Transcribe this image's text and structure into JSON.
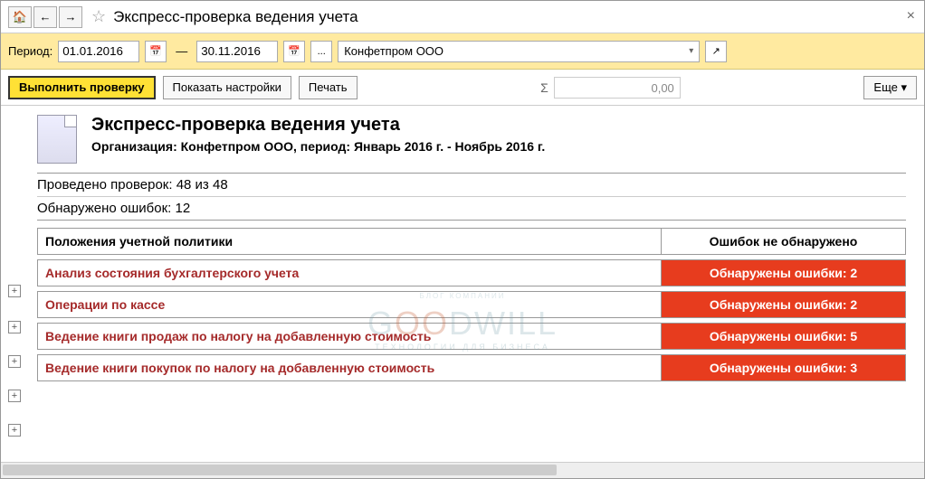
{
  "window": {
    "title": "Экспресс-проверка ведения учета"
  },
  "period": {
    "label": "Период:",
    "from": "01.01.2016",
    "to": "30.11.2016",
    "dash": "—",
    "ellipsis": "...",
    "org": "Конфетпром ООО"
  },
  "toolbar": {
    "run": "Выполнить проверку",
    "settings": "Показать настройки",
    "print": "Печать",
    "sigma": "Σ",
    "sum": "0,00",
    "more": "Еще"
  },
  "report": {
    "title": "Экспресс-проверка ведения учета",
    "subtitle": "Организация: Конфетпром ООО, период: Январь 2016 г. - Ноябрь 2016 г.",
    "checks_done": "Проведено проверок: 48 из 48",
    "errors_found": "Обнаружено ошибок: 12",
    "col_section": "Положения учетной политики",
    "col_status_ok": "Ошибок не обнаружено",
    "rows": [
      {
        "label": "Анализ состояния бухгалтерского учета",
        "status": "Обнаружены ошибки: 2"
      },
      {
        "label": "Операции по кассе",
        "status": "Обнаружены ошибки: 2"
      },
      {
        "label": "Ведение книги продаж по налогу на добавленную стоимость",
        "status": "Обнаружены ошибки: 5"
      },
      {
        "label": "Ведение книги покупок по налогу на добавленную стоимость",
        "status": "Обнаружены ошибки: 3"
      }
    ]
  },
  "watermark": {
    "top": "БЛОГ КОМПАНИИ",
    "main_a": "G",
    "main_oo": "OO",
    "main_b": "DWILL",
    "sub": "ТЕХНОЛОГИИ ДЛЯ БИЗНЕСА"
  }
}
